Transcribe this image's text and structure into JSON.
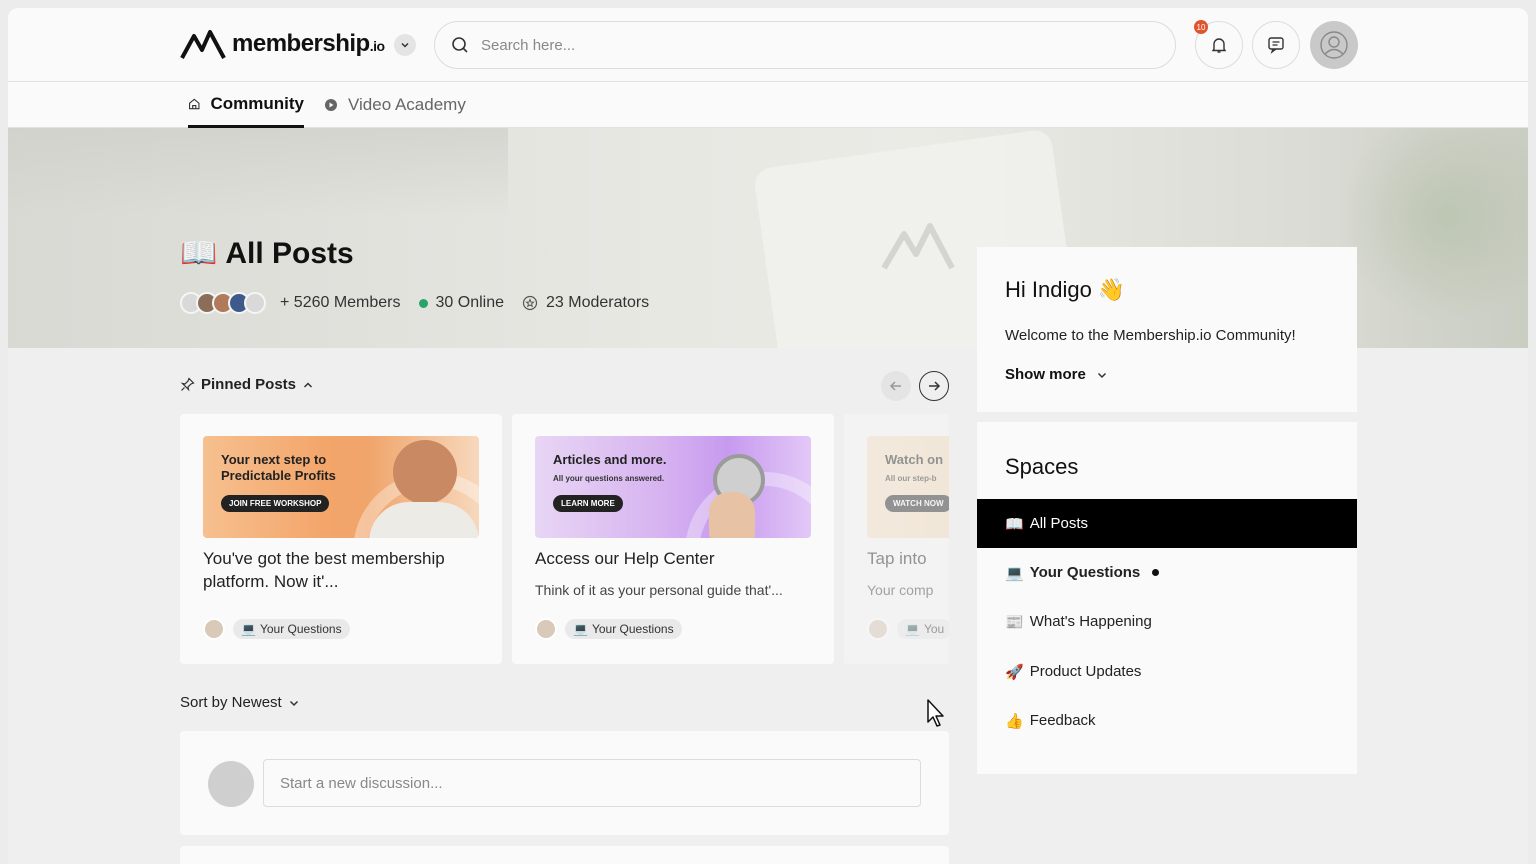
{
  "brand": {
    "logo_main": "membership",
    "logo_suffix": ".io"
  },
  "search": {
    "placeholder": "Search here..."
  },
  "notifications": {
    "count": "10"
  },
  "tabs": [
    {
      "label": "Community",
      "icon": "home-icon",
      "active": true
    },
    {
      "label": "Video Academy",
      "icon": "play-icon",
      "active": false
    }
  ],
  "hero": {
    "title_emoji": "📖",
    "title": "All Posts",
    "members": "+ 5260 Members",
    "online": "30 Online",
    "moderators": "23 Moderators"
  },
  "pinned": {
    "label": "Pinned Posts",
    "cards": [
      {
        "thumb_title": "Your next step to Predictable Profits",
        "thumb_button": "JOIN FREE WORKSHOP",
        "title": "You've got the best membership platform. Now it'...",
        "chip": "Your Questions"
      },
      {
        "thumb_title": "Articles and more.",
        "thumb_sub": "All your questions answered.",
        "thumb_button": "LEARN MORE",
        "title": "Access our Help Center",
        "desc": "Think of it as your personal guide that'...",
        "chip": "Your Questions"
      },
      {
        "thumb_title": "Watch on",
        "thumb_sub": "All our step-b",
        "thumb_button": "WATCH NOW",
        "title": "Tap into",
        "desc": "Your comp",
        "chip": "You"
      }
    ]
  },
  "sort": {
    "label": "Sort by Newest"
  },
  "composer": {
    "placeholder": "Start a new discussion..."
  },
  "welcome": {
    "greeting": "Hi Indigo",
    "wave": "👋",
    "message": "Welcome to the Membership.io Community!",
    "show_more": "Show more"
  },
  "spaces": {
    "title": "Spaces",
    "items": [
      {
        "emoji": "📖",
        "label": "All Posts",
        "active": true
      },
      {
        "emoji": "💻",
        "label": "Your Questions",
        "unread": true
      },
      {
        "emoji": "📰",
        "label": "What's Happening"
      },
      {
        "emoji": "🚀",
        "label": "Product Updates"
      },
      {
        "emoji": "👍",
        "label": "Feedback"
      }
    ]
  },
  "colors": {
    "accent": "#000000",
    "online": "#29a36a",
    "badge": "#e0552d"
  }
}
